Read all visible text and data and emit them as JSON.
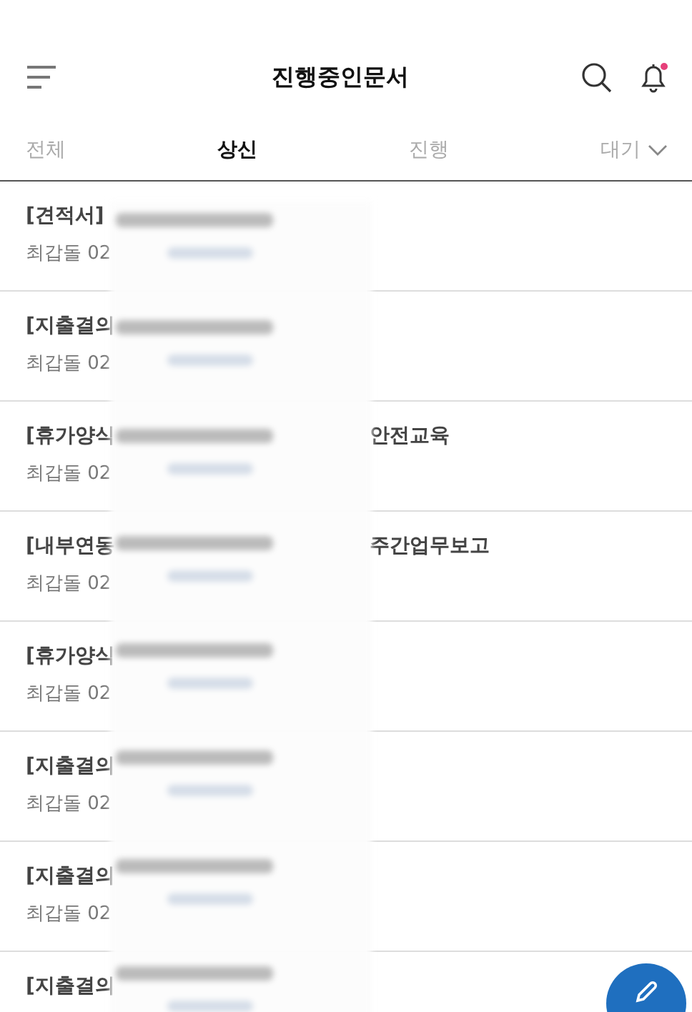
{
  "header": {
    "title": "진행중인문서",
    "has_notification": true
  },
  "tabs": [
    {
      "label": "전체",
      "selected": false,
      "dropdown": false
    },
    {
      "label": "상신",
      "selected": true,
      "dropdown": false
    },
    {
      "label": "진행",
      "selected": false,
      "dropdown": false
    },
    {
      "label": "대기",
      "selected": false,
      "dropdown": true
    }
  ],
  "documents": [
    {
      "title": "[견적서]",
      "meta": "최갑돌 02"
    },
    {
      "title": "[지출결의",
      "meta": "최갑돌 02"
    },
    {
      "title": "[휴가양식",
      "title_end": "안전교육",
      "meta": "최갑돌 02"
    },
    {
      "title": "[내부연동",
      "title_end": "주간업무보고",
      "meta": "최갑돌 02"
    },
    {
      "title": "[휴가양식",
      "meta": "최갑돌 02"
    },
    {
      "title": "[지출결의",
      "meta": "최갑돌 02"
    },
    {
      "title": "[지출결의",
      "meta": "최갑돌 02"
    },
    {
      "title": "[지출결의"
    }
  ]
}
